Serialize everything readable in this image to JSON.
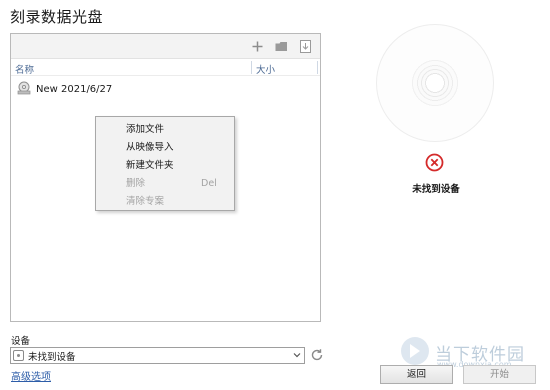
{
  "window": {
    "title": "刻录数据光盘"
  },
  "toolbar": {
    "add_icon": "plus-icon",
    "folder_icon": "folder-icon",
    "import_icon": "import-icon"
  },
  "columns": {
    "name": "名称",
    "size": "大小"
  },
  "files": [
    {
      "name": "New 2021/6/27",
      "icon": "disc-folder-icon"
    }
  ],
  "context_menu": {
    "items": [
      {
        "label": "添加文件",
        "shortcut": "",
        "enabled": true
      },
      {
        "label": "从映像导入",
        "shortcut": "",
        "enabled": true
      },
      {
        "label": "新建文件夹",
        "shortcut": "",
        "enabled": true
      },
      {
        "label": "删除",
        "shortcut": "Del",
        "enabled": false
      },
      {
        "label": "清除专案",
        "shortcut": "",
        "enabled": false
      }
    ]
  },
  "disc_panel": {
    "status": "未找到设备",
    "status_icon": "error-icon",
    "status_color": "#d42a2a"
  },
  "device": {
    "label": "设备",
    "selected": "未找到设备"
  },
  "advanced_link": "高级选项",
  "buttons": {
    "return": "返回",
    "start": "开始"
  },
  "watermark": {
    "brand": "当下软件园",
    "url": "www.downxia.com"
  }
}
